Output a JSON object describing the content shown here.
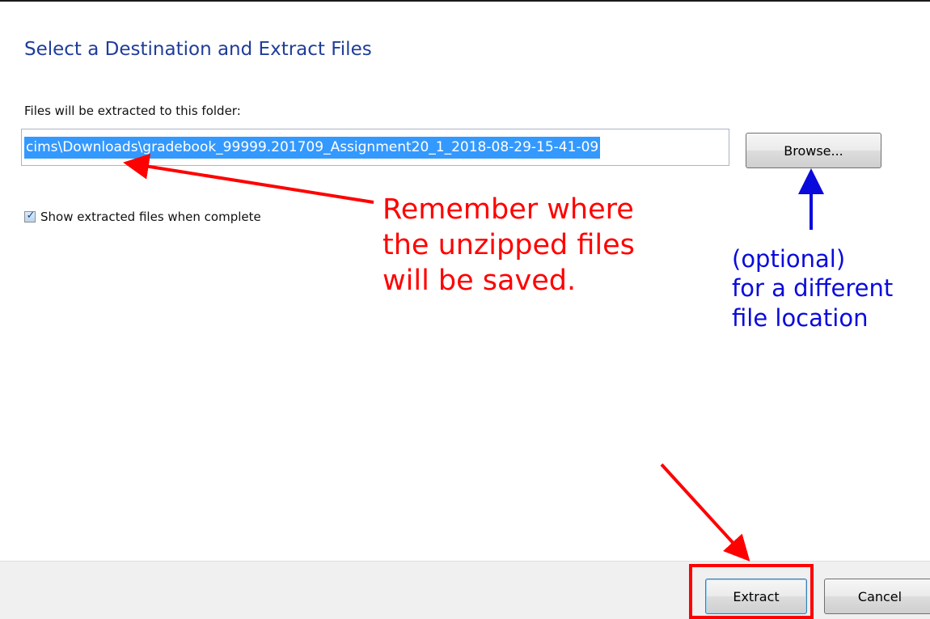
{
  "dialog": {
    "title": "Select a Destination and Extract Files",
    "path_label": "Files will be extracted to this folder:",
    "path_value": "cims\\Downloads\\gradebook_99999.201709_Assignment20_1_2018-08-29-15-41-09",
    "browse_label": "Browse...",
    "show_files_label": "Show extracted files when complete",
    "show_files_checked": true,
    "extract_label": "Extract",
    "cancel_label": "Cancel"
  },
  "annotations": {
    "remember_lines": [
      "Remember where",
      "the unzipped files",
      "will be saved."
    ],
    "optional_lines": [
      "(optional)",
      "for a different",
      "file location"
    ],
    "red_color": "#ff0000",
    "blue_color": "#0a0adc"
  },
  "icons": {
    "checkbox_check": "checkmark-icon"
  }
}
